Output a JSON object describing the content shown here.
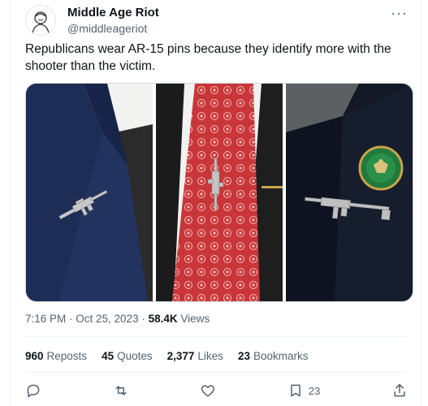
{
  "post": {
    "author_name": "Middle Age Riot",
    "author_handle": "@middleageriot",
    "more_label": "···",
    "text": "Republicans wear AR-15 pins because they identify more with the shooter than the victim.",
    "timestamp": "7:16 PM · Oct 25, 2023 · ",
    "views_count": "58.4K",
    "views_label": " Views"
  },
  "stats": [
    {
      "count": "960",
      "label": "Reposts"
    },
    {
      "count": "45",
      "label": "Quotes"
    },
    {
      "count": "2,377",
      "label": "Likes"
    },
    {
      "count": "23",
      "label": "Bookmarks"
    }
  ],
  "actions": {
    "bookmark_count": "23"
  },
  "colors": {
    "text_primary": "#0f1419",
    "text_secondary": "#536471",
    "suit_blue": "#1d2d55",
    "tie_red": "#c9363a",
    "pin_green": "#1f7a3c"
  }
}
